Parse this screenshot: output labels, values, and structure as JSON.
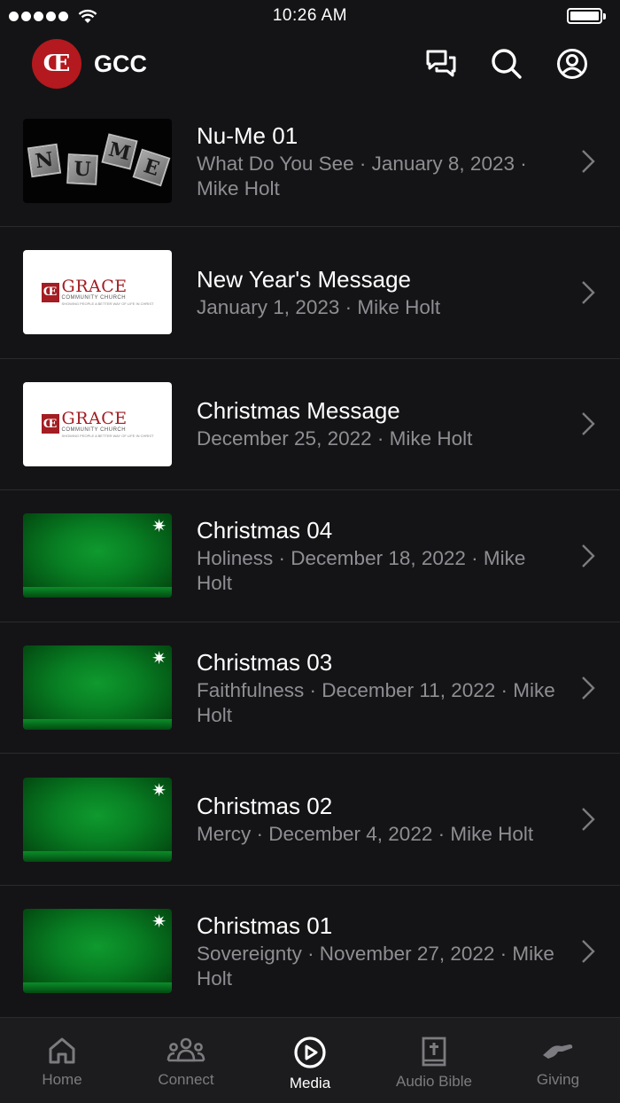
{
  "status_bar": {
    "time": "10:26 AM"
  },
  "header": {
    "app_name": "GCC",
    "logo_text": "Œ"
  },
  "thumbnails": {
    "nume_letters": [
      "N",
      "U",
      "M",
      "E"
    ],
    "grace": {
      "word": "GRACE",
      "sub": "COMMUNITY CHURCH",
      "tag": "SHOWING PEOPLE A BETTER WAY OF LIFE IN CHRIST",
      "mark": "Œ"
    },
    "sparkle": "✷"
  },
  "media_items": [
    {
      "title": "Nu-Me 01",
      "subtitle": "What Do You See · January 8, 2023 · Mike Holt",
      "thumb": "nume"
    },
    {
      "title": "New Year's Message",
      "subtitle": "January 1, 2023 · Mike Holt",
      "thumb": "grace"
    },
    {
      "title": "Christmas Message",
      "subtitle": "December 25, 2022 · Mike Holt",
      "thumb": "grace"
    },
    {
      "title": "Christmas 04",
      "subtitle": "Holiness · December 18, 2022 · Mike Holt",
      "thumb": "green"
    },
    {
      "title": "Christmas 03",
      "subtitle": "Faithfulness · December 11, 2022 · Mike Holt",
      "thumb": "green"
    },
    {
      "title": "Christmas 02",
      "subtitle": "Mercy · December 4, 2022 · Mike Holt",
      "thumb": "green"
    },
    {
      "title": "Christmas 01",
      "subtitle": "Sovereignty · November 27, 2022 · Mike Holt",
      "thumb": "green"
    }
  ],
  "tabs": [
    {
      "label": "Home",
      "icon": "home-icon"
    },
    {
      "label": "Connect",
      "icon": "people-icon"
    },
    {
      "label": "Media",
      "icon": "play-circle-icon",
      "active": true
    },
    {
      "label": "Audio Bible",
      "icon": "bible-icon"
    },
    {
      "label": "Giving",
      "icon": "giving-hand-icon"
    }
  ],
  "colors": {
    "background": "#141416",
    "accent_red": "#b3191e",
    "secondary_text": "#8e8e93",
    "tab_bar": "#1c1c1e"
  }
}
